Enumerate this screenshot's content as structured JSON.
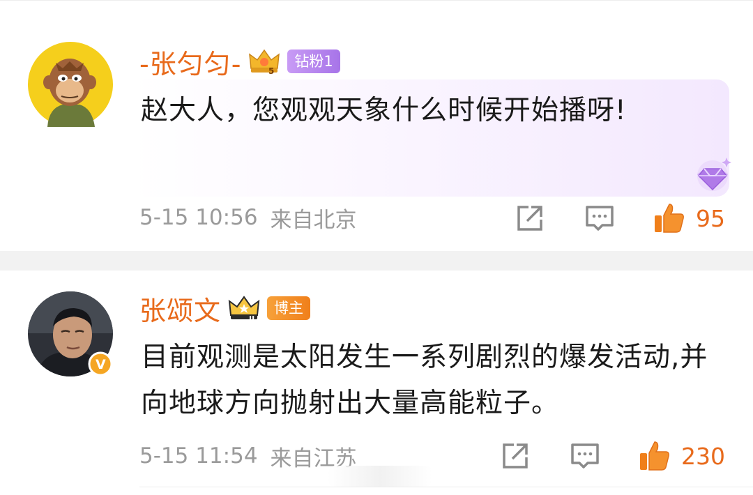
{
  "comments": [
    {
      "username": "-张匀匀-",
      "badge": "钻粉1",
      "text": "赵大人，您观观天象什么时候开始播呀!",
      "time": "5-15 10:56",
      "location": "来自北京",
      "likes": "95",
      "avatar_icon": "monkey-cartoon-avatar",
      "level_icon": "crown-5-icon"
    },
    {
      "username": "张颂文",
      "badge": "博主",
      "text": "目前观测是太阳发生一系列剧烈的爆发活动,并向地球方向抛射出大量高能粒子。",
      "time": "5-15 11:54",
      "location": "来自江苏",
      "likes": "230",
      "avatar_icon": "person-photo-avatar",
      "level_icon": "crown-2-icon"
    }
  ],
  "colors": {
    "username": "#e86a1b",
    "like": "#f07f1a",
    "meta": "#9a9a9a",
    "fan_badge": "#b584ee",
    "host_badge": "#f28a20"
  }
}
